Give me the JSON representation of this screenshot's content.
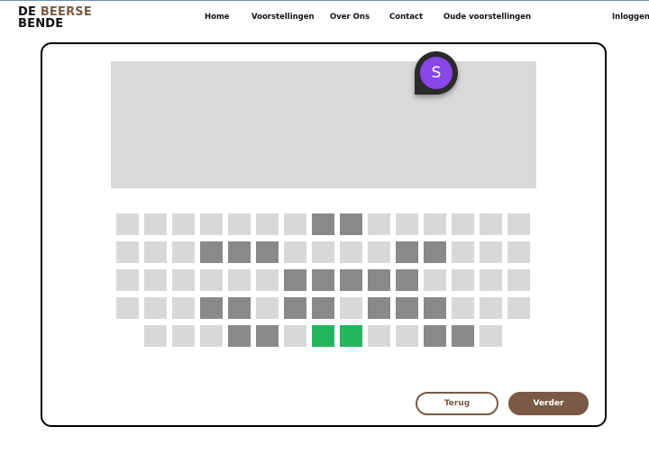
{
  "brand": {
    "line1_a": "DE",
    "line1_b": "BEERSE",
    "line2": "BENDE",
    "accent_color": "#7a5a45"
  },
  "nav": {
    "items": [
      "Home",
      "Voorstellingen",
      "Over Ons",
      "Contact",
      "Oude voorstellingen"
    ],
    "login": "Inloggen"
  },
  "stage": {
    "avatar_initial": "S",
    "avatar_color": "#8b46e8"
  },
  "seatmap": {
    "legend_colors": {
      "free": "#d8d8d8",
      "taken": "#898989",
      "selected": "#22b75f"
    },
    "rows": [
      [
        "free",
        "free",
        "free",
        "free",
        "free",
        "free",
        "free",
        "taken",
        "taken",
        "free",
        "free",
        "free",
        "free",
        "free",
        "free"
      ],
      [
        "free",
        "free",
        "free",
        "taken",
        "taken",
        "taken",
        "free",
        "free",
        "free",
        "free",
        "taken",
        "taken",
        "free",
        "free",
        "free"
      ],
      [
        "free",
        "free",
        "free",
        "free",
        "free",
        "free",
        "taken",
        "taken",
        "taken",
        "taken",
        "taken",
        "free",
        "free",
        "free",
        "free"
      ],
      [
        "free",
        "free",
        "free",
        "taken",
        "taken",
        "free",
        "taken",
        "taken",
        "free",
        "taken",
        "taken",
        "taken",
        "free",
        "free",
        "free"
      ],
      [
        "free",
        "free",
        "free",
        "taken",
        "taken",
        "free",
        "selected",
        "selected",
        "free",
        "free",
        "taken",
        "taken",
        "free"
      ]
    ]
  },
  "actions": {
    "back_label": "Terug",
    "next_label": "Verder"
  }
}
